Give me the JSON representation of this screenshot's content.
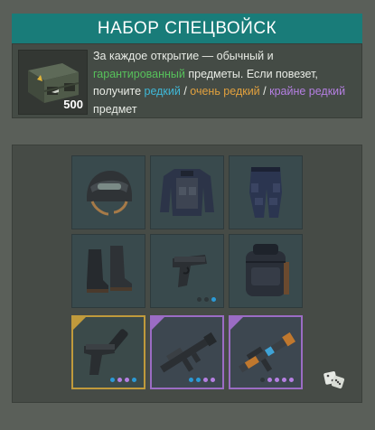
{
  "header": {
    "title": "НАБОР СПЕЦВОЙСК"
  },
  "chest": {
    "icon": "weapon-crate-icon",
    "price": "500"
  },
  "description": {
    "part1": "За каждое открытие — обычный и ",
    "guaranteed": "гарантированный",
    "part2": " предметы. Если повезет, получите ",
    "rare": "редкий",
    "sep1": " / ",
    "very_rare": "очень редкий",
    "sep2": " / ",
    "extremely_rare": "крайне редкий",
    "part3": " предмет"
  },
  "colors": {
    "title_bg": "#197c79",
    "guaranteed": "#57c15b",
    "rare": "#3fb8d8",
    "very_rare": "#e2a13e",
    "extremely_rare": "#b57fe2"
  },
  "items": [
    {
      "name": "helmet-icon",
      "rarity": "common",
      "dots": []
    },
    {
      "name": "tactical-jacket-icon",
      "rarity": "common",
      "dots": []
    },
    {
      "name": "tactical-pants-icon",
      "rarity": "common",
      "dots": []
    },
    {
      "name": "combat-boots-icon",
      "rarity": "common",
      "dots": []
    },
    {
      "name": "pistol-icon",
      "rarity": "common",
      "dots": [
        "#2d3538",
        "#2d3538",
        "#2b9ad6"
      ]
    },
    {
      "name": "backpack-icon",
      "rarity": "common",
      "dots": []
    },
    {
      "name": "silenced-pistol-icon",
      "rarity": "gold",
      "dots": [
        "#2b9ad6",
        "#b57fe2",
        "#b57fe2",
        "#2b9ad6"
      ]
    },
    {
      "name": "assault-rifle-icon",
      "rarity": "violet",
      "dots": [
        "#2b9ad6",
        "#2b9ad6",
        "#b57fe2",
        "#b57fe2"
      ]
    },
    {
      "name": "camo-rifle-icon",
      "rarity": "violet",
      "dots": [
        "#2d3538",
        "#b57fe2",
        "#b57fe2",
        "#b57fe2",
        "#b57fe2"
      ]
    }
  ],
  "footer": {
    "dice_icon": "dice-icon"
  }
}
